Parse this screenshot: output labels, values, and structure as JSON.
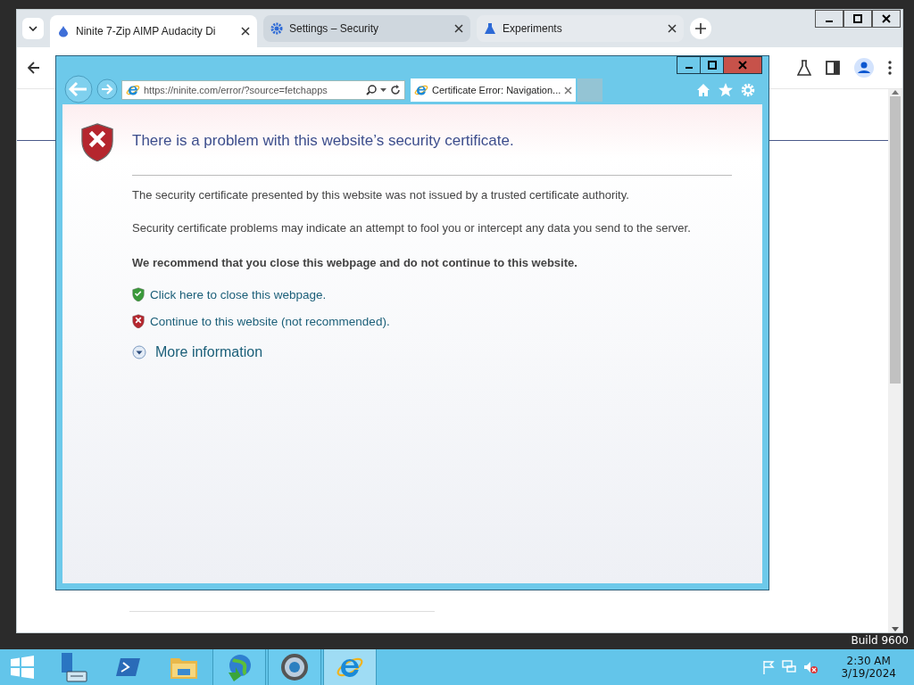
{
  "browser": {
    "tabs": [
      {
        "title": "Ninite 7-Zip AIMP Audacity Di",
        "selected": true
      },
      {
        "title": "Settings – Security",
        "selected": false
      },
      {
        "title": "Experiments",
        "selected": false
      }
    ]
  },
  "ie": {
    "address": "https://ninite.com/error/?source=fetchapps",
    "tab": "Certificate Error: Navigation...",
    "heading": "There is a problem with this website’s security certificate.",
    "paragraphs": [
      "The security certificate presented by this website was not issued by a trusted certificate authority.",
      "Security certificate problems may indicate an attempt to fool you or intercept any data you send to the server."
    ],
    "recommendation": "We recommend that you close this webpage and do not continue to this website.",
    "links": [
      {
        "kind": "safe",
        "text": "Click here to close this webpage."
      },
      {
        "kind": "unsafe",
        "text": "Continue to this website (not recommended)."
      }
    ],
    "more": "More information"
  },
  "desktop": {
    "build": "Build 9600"
  },
  "taskbar": {
    "apps": [
      {
        "kind": "server",
        "running": false,
        "selected": false
      },
      {
        "kind": "shell",
        "running": false,
        "selected": false
      },
      {
        "kind": "folder",
        "running": false,
        "selected": false
      },
      {
        "kind": "globe",
        "running": true,
        "selected": false
      },
      {
        "kind": "orb",
        "running": true,
        "selected": false
      },
      {
        "kind": "ie",
        "running": true,
        "selected": true
      }
    ],
    "time": "2:30 AM",
    "date": "3/19/2024"
  }
}
